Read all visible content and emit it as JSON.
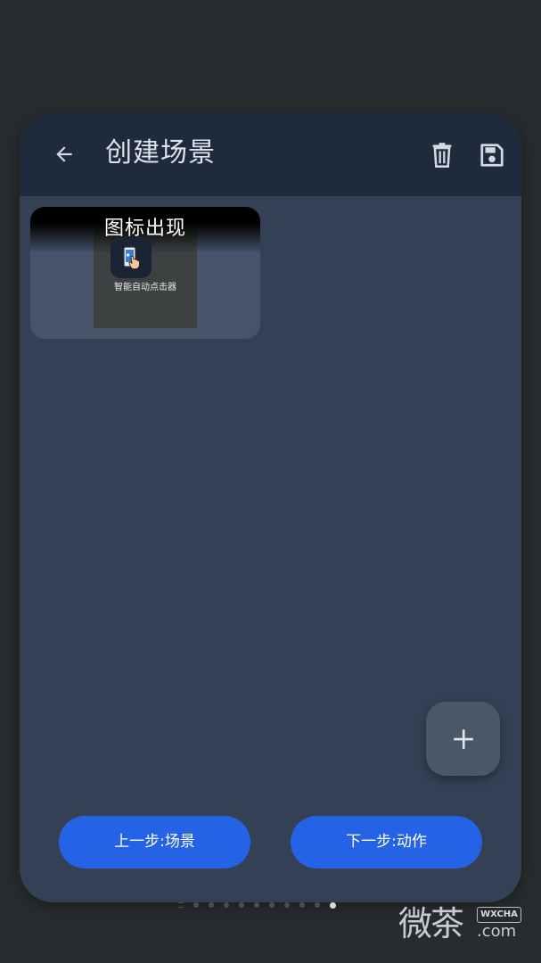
{
  "header": {
    "title": "创建场景",
    "back_icon": "arrow-left-icon",
    "delete_icon": "trash-icon",
    "save_icon": "floppy-disk-icon"
  },
  "conditions": [
    {
      "title": "图标出现",
      "app_name": "智能自动点击器"
    }
  ],
  "fab": {
    "icon": "plus-icon"
  },
  "footer": {
    "prev_label": "上一步:场景",
    "next_label": "下一步:动作"
  },
  "pager": {
    "count": 11,
    "active_index": 10
  },
  "watermark": {
    "text": "微茶",
    "badge": "WXCHA",
    "suffix": ".com"
  },
  "colors": {
    "background": "#292c2e",
    "dialog": "#344155",
    "appbar": "#1f2a3c",
    "primary_button": "#2563e6",
    "card": "#46536a"
  }
}
